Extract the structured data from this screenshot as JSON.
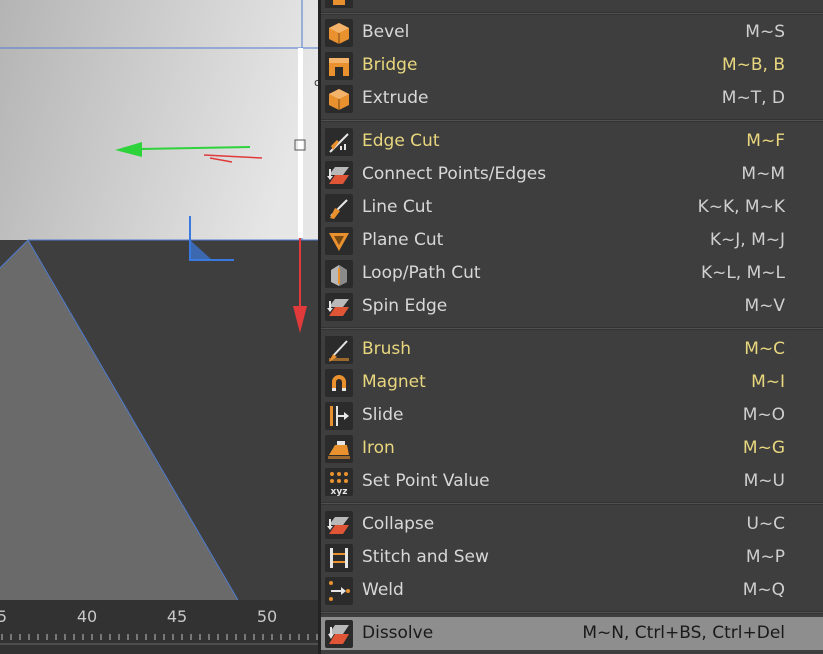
{
  "timeline": {
    "ticks": [
      "5",
      "40",
      "45",
      "50"
    ]
  },
  "menu": {
    "groups": [
      {
        "items": [
          {
            "label": "Bevel",
            "shortcut": "M~S",
            "icon": "bevel-icon",
            "highlight": false
          },
          {
            "label": "Bridge",
            "shortcut": "M~B, B",
            "icon": "bridge-icon",
            "highlight": true
          },
          {
            "label": "Extrude",
            "shortcut": "M~T, D",
            "icon": "extrude-icon",
            "highlight": false
          }
        ]
      },
      {
        "items": [
          {
            "label": "Edge Cut",
            "shortcut": "M~F",
            "icon": "edge-cut-icon",
            "highlight": true
          },
          {
            "label": "Connect Points/Edges",
            "shortcut": "M~M",
            "icon": "connect-points-edges-icon",
            "highlight": false
          },
          {
            "label": "Line Cut",
            "shortcut": "K~K, M~K",
            "icon": "line-cut-icon",
            "highlight": false
          },
          {
            "label": "Plane Cut",
            "shortcut": "K~J, M~J",
            "icon": "plane-cut-icon",
            "highlight": false
          },
          {
            "label": "Loop/Path Cut",
            "shortcut": "K~L, M~L",
            "icon": "loop-path-cut-icon",
            "highlight": false
          },
          {
            "label": "Spin Edge",
            "shortcut": "M~V",
            "icon": "spin-edge-icon",
            "highlight": false
          }
        ]
      },
      {
        "items": [
          {
            "label": "Brush",
            "shortcut": "M~C",
            "icon": "brush-icon",
            "highlight": true
          },
          {
            "label": "Magnet",
            "shortcut": "M~I",
            "icon": "magnet-icon",
            "highlight": true
          },
          {
            "label": "Slide",
            "shortcut": "M~O",
            "icon": "slide-icon",
            "highlight": false
          },
          {
            "label": "Iron",
            "shortcut": "M~G",
            "icon": "iron-icon",
            "highlight": true
          },
          {
            "label": "Set Point Value",
            "shortcut": "M~U",
            "icon": "set-point-value-icon",
            "highlight": false
          }
        ]
      },
      {
        "items": [
          {
            "label": "Collapse",
            "shortcut": "U~C",
            "icon": "collapse-icon",
            "highlight": false
          },
          {
            "label": "Stitch and Sew",
            "shortcut": "M~P",
            "icon": "stitch-and-sew-icon",
            "highlight": false
          },
          {
            "label": "Weld",
            "shortcut": "M~Q",
            "icon": "weld-icon",
            "highlight": false
          }
        ]
      },
      {
        "items": [
          {
            "label": "Dissolve",
            "shortcut": "M~N, Ctrl+BS, Ctrl+Del",
            "icon": "dissolve-icon",
            "highlight": false,
            "selected": true
          }
        ]
      }
    ]
  },
  "colors": {
    "highlight_text": "#e8d77e",
    "normal_text": "#d8d8d8",
    "selected_row": "#8e8e8e",
    "icon_orange": "#e8912e",
    "axis_x": "#e03a3a",
    "axis_y": "#2ed33c",
    "axis_z": "#3a7ae0"
  }
}
